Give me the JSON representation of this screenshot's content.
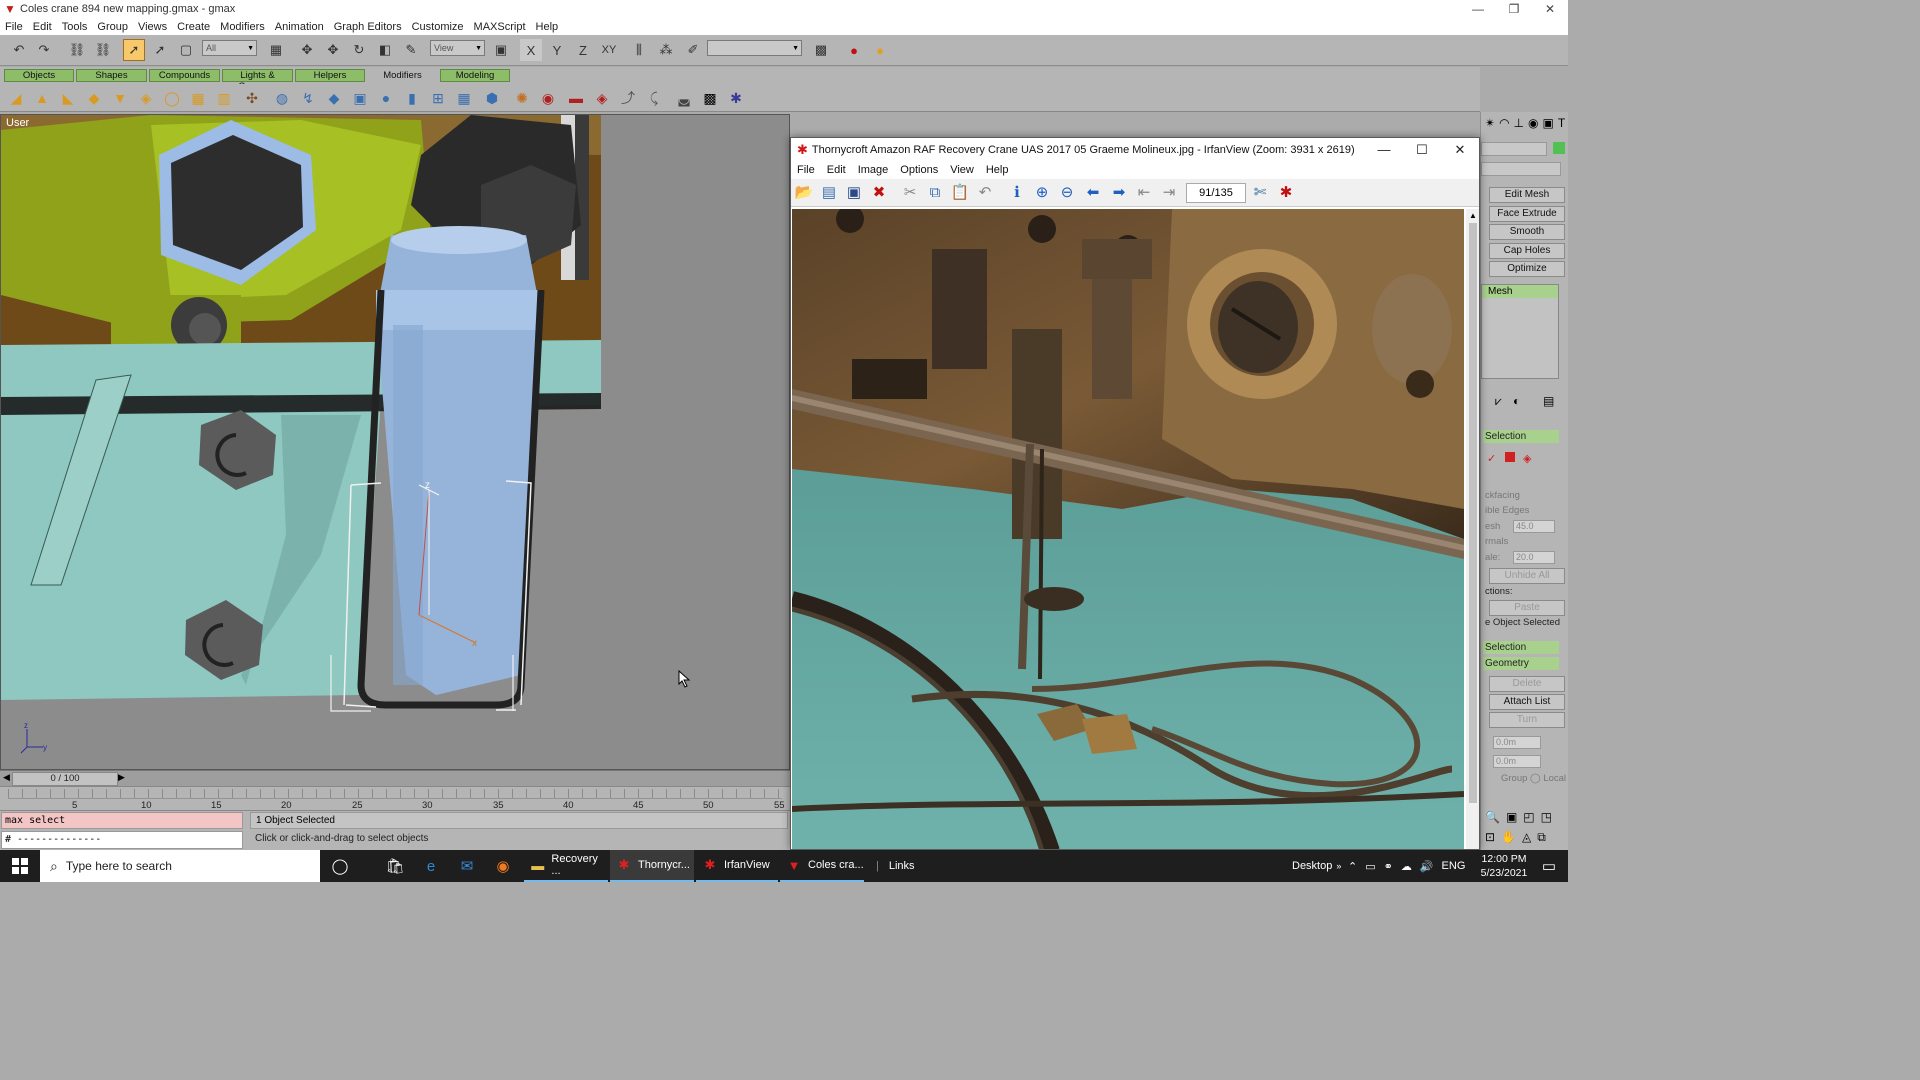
{
  "gmax": {
    "title": "Coles crane 894 new mapping.gmax - gmax",
    "menu": [
      "File",
      "Edit",
      "Tools",
      "Group",
      "Views",
      "Create",
      "Modifiers",
      "Animation",
      "Graph Editors",
      "Customize",
      "MAXScript",
      "Help"
    ],
    "selection_filter": "All",
    "ref_coord": "View",
    "tabs": [
      "Objects",
      "Shapes",
      "Compounds",
      "Lights & Cameras",
      "Helpers",
      "Modifiers",
      "Modeling"
    ],
    "active_tab": "Modifiers",
    "viewport_label": "User",
    "timeline_position": "0 / 100",
    "track_ticks": [
      "5",
      "10",
      "15",
      "20",
      "25",
      "30",
      "35",
      "40",
      "45",
      "50",
      "55"
    ],
    "maxscript_line1": "max select",
    "maxscript_line2": "# --------------",
    "status_selection": "1 Object Selected",
    "status_prompt": "Click or click-and-drag to select objects",
    "command_panel": {
      "buttons": [
        "Edit Mesh",
        "Face Extrude",
        "Smooth",
        "Cap Holes",
        "Optimize"
      ],
      "stack_item": "Mesh",
      "section_selection": "Selection",
      "backfacing": "ckfacing",
      "visible_edges": "ible Edges",
      "thresh_label": "esh",
      "thresh_value": "45.0",
      "normals": "rmals",
      "scale_label": "ale:",
      "scale_value": "20.0",
      "unhide_all": "Unhide All",
      "ops_label": "ctions:",
      "paste": "Paste",
      "object_selected": "e Object Selected",
      "soft_selection": "Selection",
      "edit_geometry": "Geometry",
      "delete": "Delete",
      "attach_list": "Attach List",
      "turn": "Turn",
      "spin1": "0.0m",
      "spin2": "0.0m",
      "group_local": "Group  ◯ Local"
    }
  },
  "irfan": {
    "title": "Thornycroft Amazon RAF Recovery Crane UAS 2017 05 Graeme Molineux.jpg - IrfanView (Zoom: 3931 x 2619)",
    "menu": [
      "File",
      "Edit",
      "Image",
      "Options",
      "View",
      "Help"
    ],
    "page_counter": "91/135"
  },
  "taskbar": {
    "search_placeholder": "Type here to search",
    "apps": [
      {
        "label": "Recovery ...",
        "icon": "folder-icon"
      },
      {
        "label": "Thornycr...",
        "icon": "irfanview-icon"
      },
      {
        "label": "IrfanView",
        "icon": "irfanview-icon"
      },
      {
        "label": "Coles cra...",
        "icon": "gmax-icon"
      }
    ],
    "links": "Links",
    "desktop": "Desktop",
    "language": "ENG",
    "time": "12:00 PM",
    "date": "5/23/2021"
  }
}
